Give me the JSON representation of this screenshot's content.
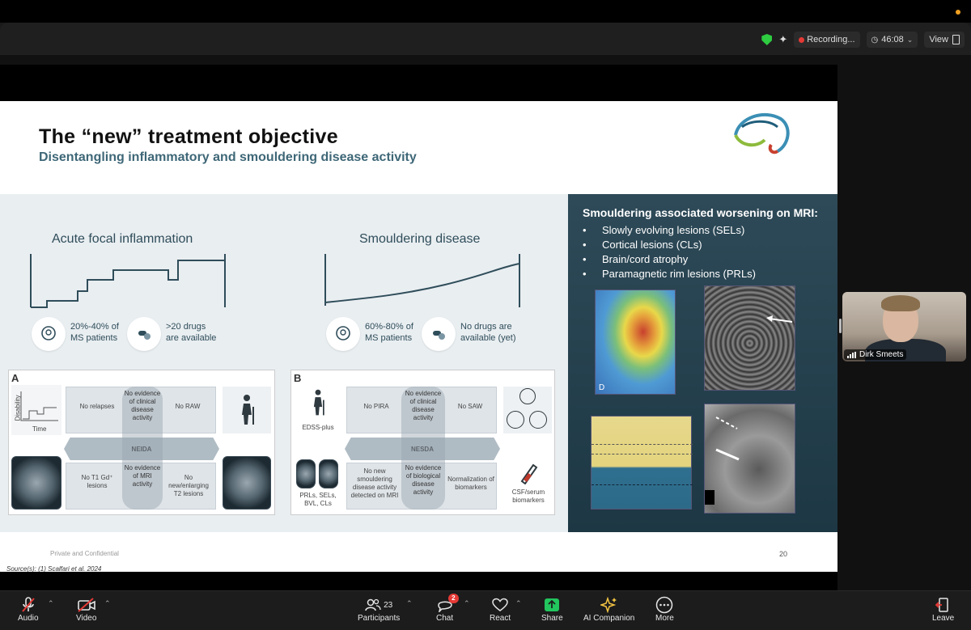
{
  "topbar": {
    "recording_label": "Recording...",
    "timer": "46:08",
    "view_label": "View"
  },
  "slide": {
    "title": "The “new” treatment objective",
    "subtitle": "Disentangling inflammatory and smouldering disease activity",
    "acute": {
      "heading": "Acute focal inflammation",
      "stat1_line1": "20%-40% of",
      "stat1_line2": "MS patients",
      "stat2_line1": ">20 drugs",
      "stat2_line2": "are  available"
    },
    "smouldering": {
      "heading": "Smouldering disease",
      "stat1_line1": "60%-80% of",
      "stat1_line2": "MS patients",
      "stat2_line1": "No drugs are",
      "stat2_line2": "available (yet)"
    },
    "figA": {
      "letter": "A",
      "y_label": "Disability",
      "x_label": "Time",
      "top_left": "No relapses",
      "top_center": "No evidence of clinical disease activity",
      "top_right": "No RAW",
      "band": "NEIDA",
      "bottom_left": "No T1 Gd⁺ lesions",
      "bottom_center": "No evidence of MRI activity",
      "bottom_right": "No new/enlarging T2 lesions"
    },
    "figB": {
      "letter": "B",
      "edss": "EDSS-plus",
      "top_left": "No PIRA",
      "top_center": "No evidence of clinical disease activity",
      "top_right": "No SAW",
      "band": "NESDA",
      "bottom_left": "No new smouldering disease activity detected on MRI",
      "bottom_center": "No evidence of biological disease activity",
      "bottom_right": "Normalization of biomarkers",
      "prl_label": "PRLs, SELs, BVL, CLs",
      "csf_label": "CSF/serum biomarkers"
    },
    "right_panel": {
      "title": "Smouldering associated worsening on MRI:",
      "items": [
        "Slowly evolving lesions (SELs)",
        "Cortical lesions (CLs)",
        "Brain/cord atrophy",
        "Paramagnetic rim lesions (PRLs)"
      ],
      "img_label": "D"
    },
    "footer_left": "Private and Confidential",
    "page_number": "20",
    "source": "Source(s): (1) Scalfari et al. 2024"
  },
  "participant": {
    "name": "Dirk Smeets"
  },
  "toolbar": {
    "audio": "Audio",
    "video": "Video",
    "participants": "Participants",
    "participants_count": "23",
    "chat": "Chat",
    "chat_badge": "2",
    "react": "React",
    "share": "Share",
    "ai": "AI Companion",
    "more": "More",
    "leave": "Leave"
  },
  "colors": {
    "accent_green": "#2ecc40",
    "share_green": "#22c55e",
    "record_red": "#e53935",
    "slide_teal": "#3e6777",
    "panel_dark": "#1d3744"
  }
}
